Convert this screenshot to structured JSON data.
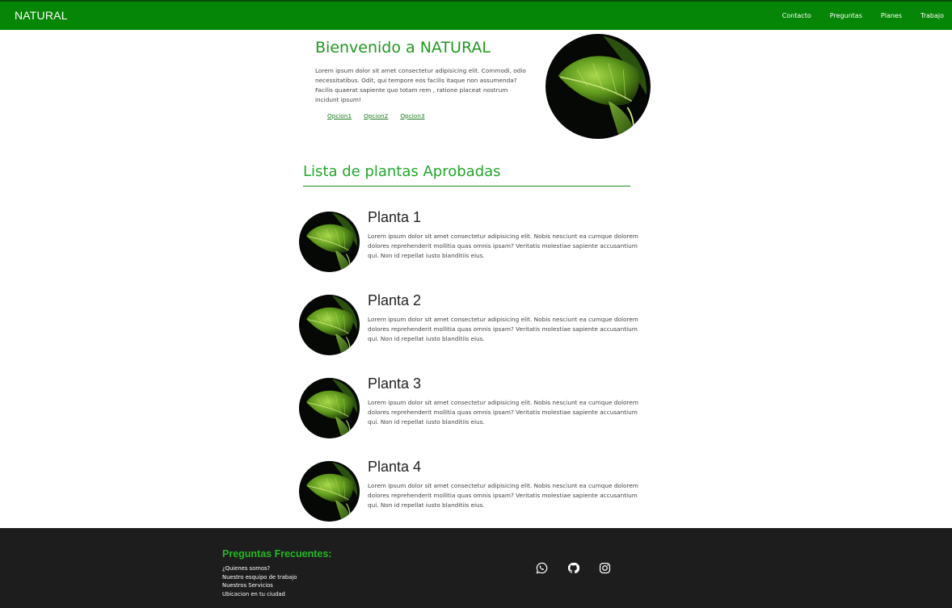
{
  "navbar": {
    "brand": "NATURAL",
    "links": [
      "Contacto",
      "Preguntas",
      "Planes",
      "Trabajo"
    ],
    "background_color": "#068606"
  },
  "hero": {
    "title": "Bienvenido a NATURAL",
    "text": "Lorem ipsum dolor sit amet consectetur adipisicing elit. Commodi, odio necessitatibus. Odit, qui tempore eos facilis itaque non assumenda? Facilis quaerat sapiente quo totam rem , ratione placeat nostrum incidunt ipsum!",
    "links": [
      "Opcion1",
      "Opcion2",
      "Opcion3"
    ],
    "image_icon": "leaf-photo"
  },
  "list": {
    "title": "Lista de plantas Aprobadas",
    "items": [
      {
        "name": "Planta 1",
        "description": "Lorem ipsum dolor sit amet consectetur adipisicing elit. Nobis nesciunt ea cumque dolorem dolores reprehenderit mollitia quas omnis ipsam? Veritatis molestiae sapiente accusantium qui. Non id repellat iusto blanditiis eius."
      },
      {
        "name": "Planta 2",
        "description": "Lorem ipsum dolor sit amet consectetur adipisicing elit. Nobis nesciunt ea cumque dolorem dolores reprehenderit mollitia quas omnis ipsam? Veritatis molestiae sapiente accusantium qui. Non id repellat iusto blanditiis eius."
      },
      {
        "name": "Planta 3",
        "description": "Lorem ipsum dolor sit amet consectetur adipisicing elit. Nobis nesciunt ea cumque dolorem dolores reprehenderit mollitia quas omnis ipsam? Veritatis molestiae sapiente accusantium qui. Non id repellat iusto blanditiis eius."
      },
      {
        "name": "Planta 4",
        "description": "Lorem ipsum dolor sit amet consectetur adipisicing elit. Nobis nesciunt ea cumque dolorem dolores reprehenderit mollitia quas omnis ipsam? Veritatis molestiae sapiente accusantium qui. Non id repellat iusto blanditiis eius."
      }
    ]
  },
  "footer": {
    "title": "Preguntas Frecuentes:",
    "links": [
      "¿Quienes somos?",
      "Nuestro esquipo de trabajo",
      "Nuestros Servicios",
      "Ubicacion en tu ciudad"
    ],
    "social_icons": [
      "whatsapp-icon",
      "github-icon",
      "instagram-icon"
    ],
    "background_color": "#1d1d1d"
  },
  "colors": {
    "accent_green": "#1e9a1e",
    "link_green": "#1e7a1e"
  }
}
